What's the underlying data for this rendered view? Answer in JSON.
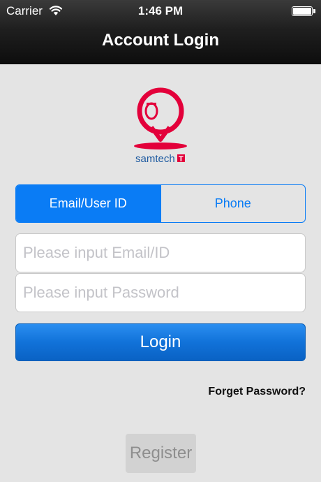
{
  "status_bar": {
    "carrier": "Carrier",
    "time": "1:46 PM",
    "icons": [
      "wifi-icon",
      "battery-icon"
    ]
  },
  "nav": {
    "title": "Account Login"
  },
  "logo": {
    "brand_text": "samtech",
    "brand_color": "#e3003a"
  },
  "login_type": {
    "options": [
      {
        "label": "Email/User ID",
        "selected": true
      },
      {
        "label": "Phone",
        "selected": false
      }
    ]
  },
  "form": {
    "email_placeholder": "Please input Email/ID",
    "password_placeholder": "Please input Password",
    "login_label": "Login",
    "forgot_label": "Forget Password?",
    "register_label": "Register"
  },
  "colors": {
    "accent": "#0a7cf5",
    "background": "#e4e4e4",
    "navbar": "#1a1a1a"
  }
}
